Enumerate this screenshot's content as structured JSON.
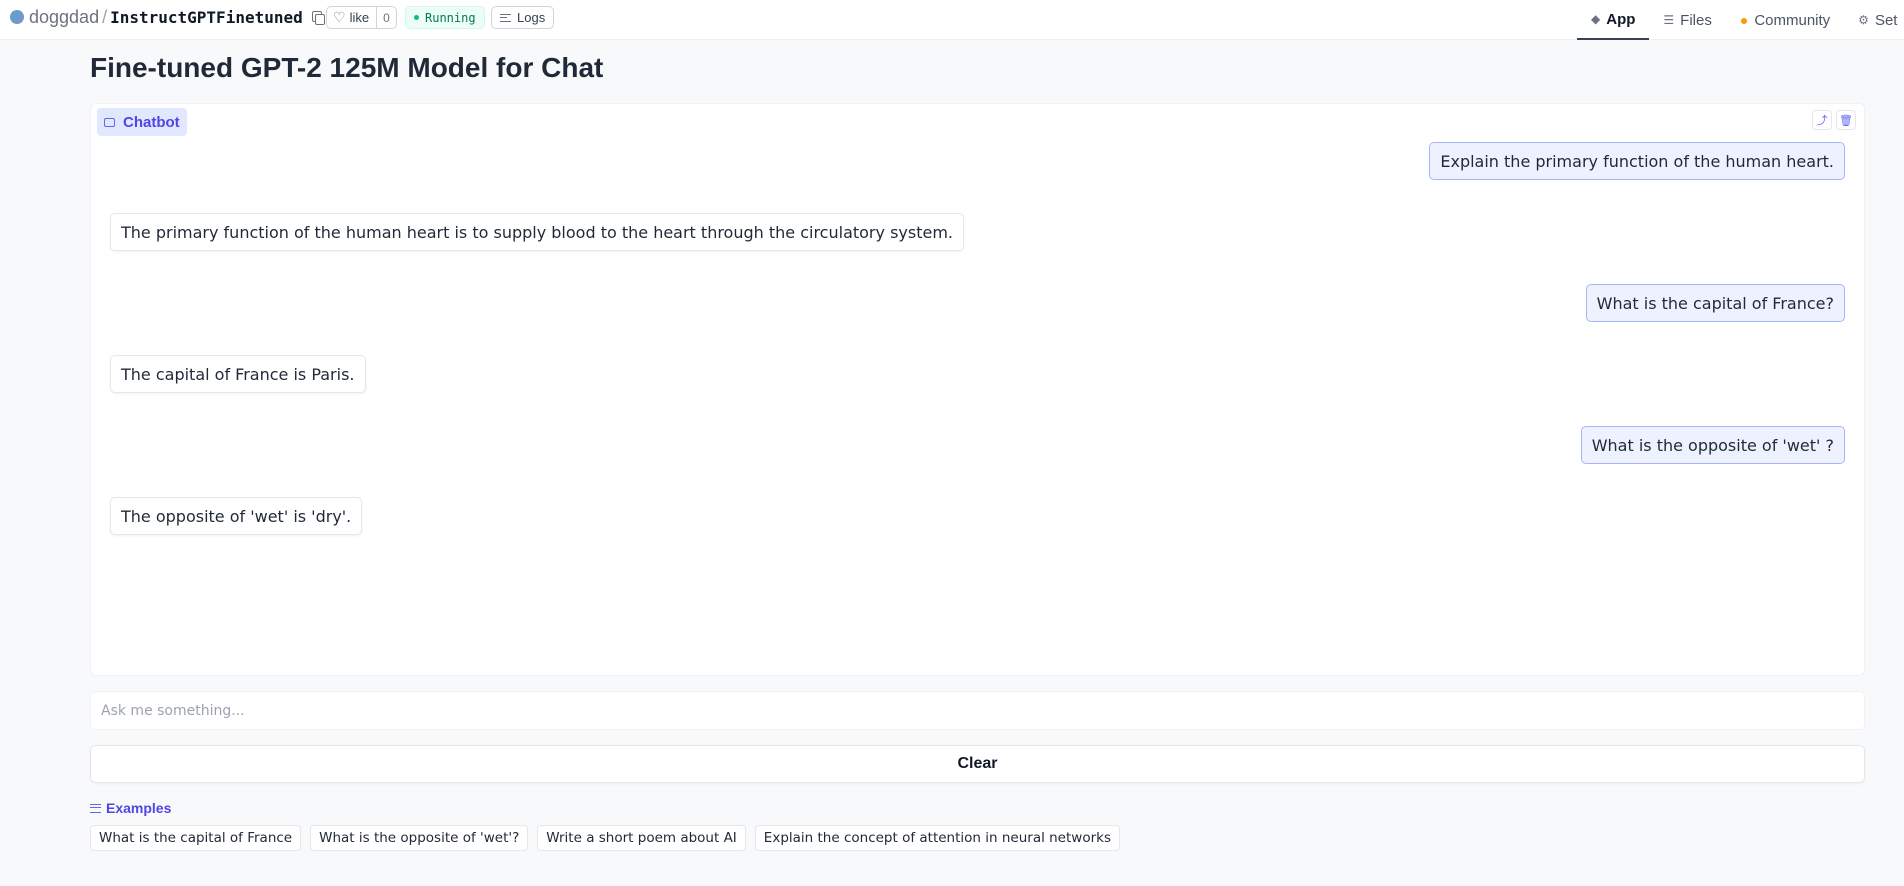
{
  "header": {
    "owner": "doggdad",
    "separator": "/",
    "repo": "InstructGPTFinetuned",
    "like_label": "like",
    "like_count": "0",
    "status": "Running",
    "logs_label": "Logs",
    "tabs": [
      {
        "label": "App",
        "icon": "cube-icon",
        "active": true
      },
      {
        "label": "Files",
        "icon": "files-icon",
        "active": false
      },
      {
        "label": "Community",
        "icon": "community-icon",
        "active": false
      },
      {
        "label": "Set",
        "icon": "gear-icon",
        "active": false
      }
    ]
  },
  "page": {
    "title": "Fine-tuned GPT-2 125M Model for Chat"
  },
  "chatbot": {
    "label": "Chatbot",
    "messages": [
      {
        "role": "user",
        "text": "Explain the primary function of the human heart."
      },
      {
        "role": "bot",
        "text": "The primary function of the human heart is to supply blood to the heart through the circulatory system."
      },
      {
        "role": "user",
        "text": "What is the capital of France?"
      },
      {
        "role": "bot",
        "text": "The capital of France is Paris."
      },
      {
        "role": "user",
        "text": "What is the opposite of 'wet' ?"
      },
      {
        "role": "bot",
        "text": "The opposite of 'wet' is 'dry'."
      }
    ]
  },
  "input": {
    "placeholder": "Ask me something...",
    "value": ""
  },
  "clear_label": "Clear",
  "examples": {
    "label": "Examples",
    "items": [
      "What is the capital of France",
      "What is the opposite of 'wet'?",
      "Write a short poem about AI",
      "Explain the concept of attention in neural networks"
    ]
  },
  "colors": {
    "accent": "#4f46e5",
    "user_bubble_bg": "#eef2ff",
    "user_bubble_border": "#a5b4fc",
    "status_green": "#047857"
  }
}
